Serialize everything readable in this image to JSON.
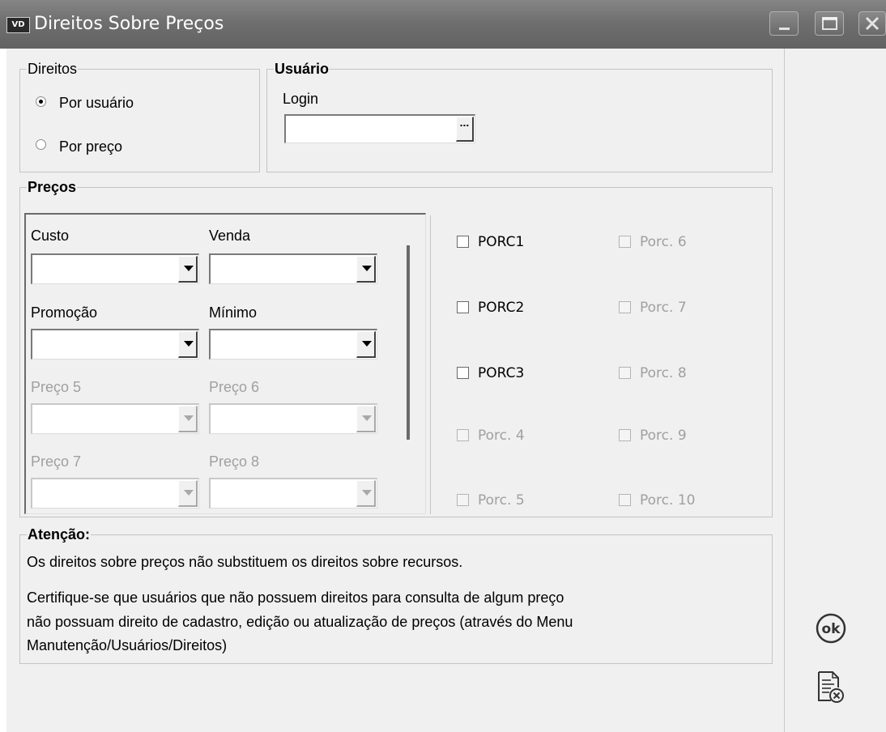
{
  "window": {
    "icon_text": "VD",
    "title": "Direitos Sobre Preços"
  },
  "direitos": {
    "title": "Direitos",
    "options": [
      {
        "label": "Por usuário",
        "selected": true
      },
      {
        "label": "Por preço",
        "selected": false
      }
    ]
  },
  "usuario": {
    "title": "Usuário",
    "login_label": "Login",
    "login_value": "",
    "lookup_button": "..."
  },
  "precos": {
    "title": "Preços",
    "combos": [
      {
        "label": "Custo",
        "value": "",
        "enabled": true
      },
      {
        "label": "Venda",
        "value": "",
        "enabled": true
      },
      {
        "label": "Promoção",
        "value": "",
        "enabled": true
      },
      {
        "label": "Mínimo",
        "value": "",
        "enabled": true
      },
      {
        "label": "Preço 5",
        "value": "",
        "enabled": false
      },
      {
        "label": "Preço 6",
        "value": "",
        "enabled": false
      },
      {
        "label": "Preço 7",
        "value": "",
        "enabled": false
      },
      {
        "label": "Preço 8",
        "value": "",
        "enabled": false
      }
    ],
    "checks": [
      {
        "label": "PORC1",
        "checked": false,
        "enabled": true
      },
      {
        "label": "PORC2",
        "checked": false,
        "enabled": true
      },
      {
        "label": "PORC3",
        "checked": false,
        "enabled": true
      },
      {
        "label": "Porc. 4",
        "checked": false,
        "enabled": false
      },
      {
        "label": "Porc. 5",
        "checked": false,
        "enabled": false
      },
      {
        "label": "Porc. 6",
        "checked": false,
        "enabled": false
      },
      {
        "label": "Porc. 7",
        "checked": false,
        "enabled": false
      },
      {
        "label": "Porc. 8",
        "checked": false,
        "enabled": false
      },
      {
        "label": "Porc. 9",
        "checked": false,
        "enabled": false
      },
      {
        "label": "Porc. 10",
        "checked": false,
        "enabled": false
      }
    ]
  },
  "atencao": {
    "title": "Atenção:",
    "line1": "Os direitos sobre preços não substituem os direitos sobre recursos.",
    "line2": "Certifique-se que usuários que não possuem direitos para consulta de algum preço",
    "line3": "não possuam direito de cadastro, edição ou atualização de preços (através do Menu",
    "line4": "Manutenção/Usuários/Direitos)"
  },
  "actions": {
    "ok_icon": "ok-circle-icon",
    "ok_text": "ok",
    "cancel_icon": "document-cancel-icon"
  },
  "colors": {
    "titlebar": "#6f6f6f",
    "client_bg": "#f0f0f0",
    "disabled_text": "#a0a0a0"
  }
}
